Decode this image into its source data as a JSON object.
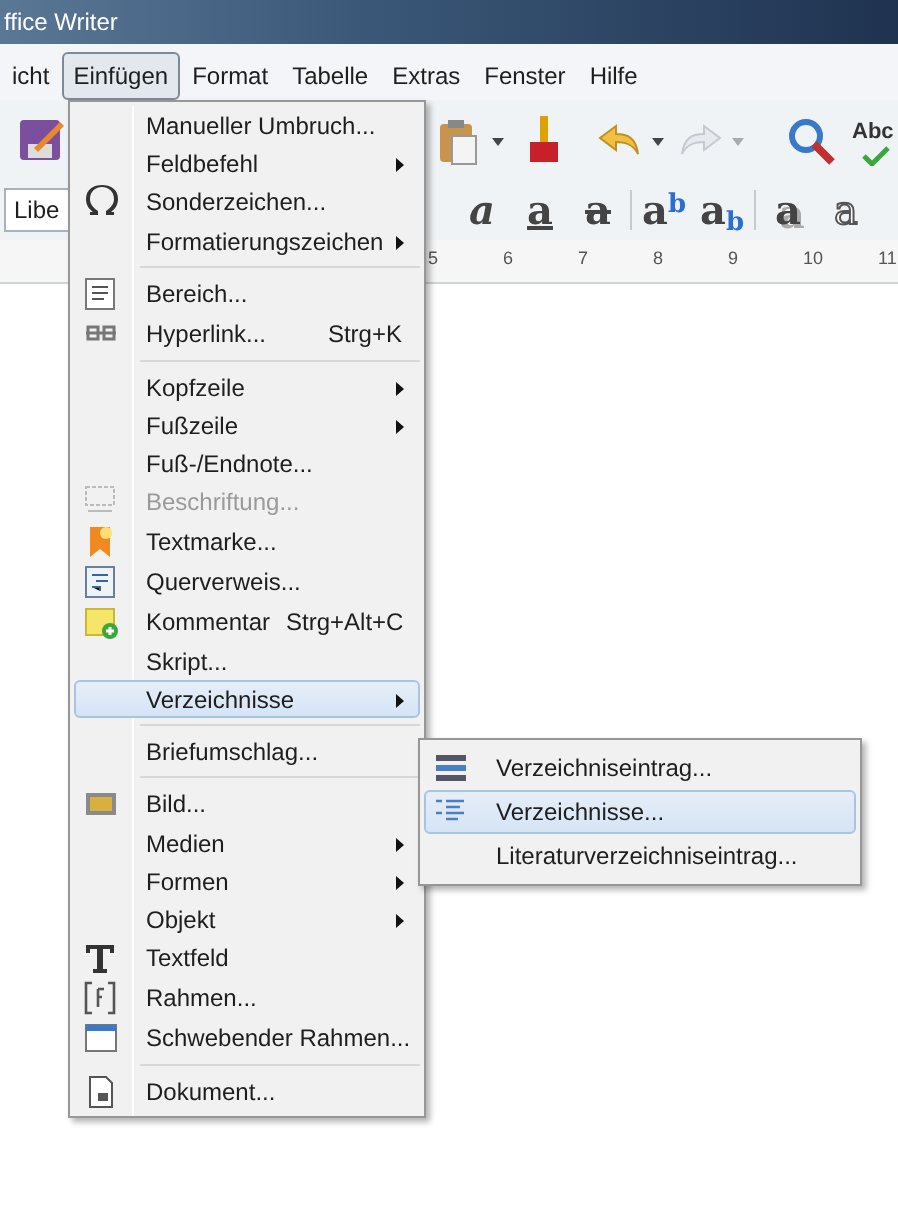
{
  "window": {
    "title": "ffice Writer"
  },
  "menubar": [
    {
      "label": "icht",
      "selected": false
    },
    {
      "label": "Einfügen",
      "selected": true
    },
    {
      "label": "Format",
      "selected": false
    },
    {
      "label": "Tabelle",
      "selected": false
    },
    {
      "label": "Extras",
      "selected": false
    },
    {
      "label": "Fenster",
      "selected": false
    },
    {
      "label": "Hilfe",
      "selected": false
    }
  ],
  "toolbar": {
    "font_name": "Libe",
    "spellcheck_label": "Abc"
  },
  "format_buttons": [
    {
      "kind": "italic",
      "label": "a"
    },
    {
      "kind": "underline",
      "label": "a"
    },
    {
      "kind": "strike",
      "label": "a"
    },
    {
      "kind": "sep"
    },
    {
      "kind": "superscript",
      "label": "a$^{b}$"
    },
    {
      "kind": "subscript",
      "label": "a$_{b}$"
    },
    {
      "kind": "sep"
    },
    {
      "kind": "shadow",
      "label": "a"
    },
    {
      "kind": "outline",
      "label": "a"
    }
  ],
  "ruler": {
    "numbers": [
      "5",
      "6",
      "7",
      "8",
      "9",
      "10",
      "11"
    ]
  },
  "menu": {
    "items": [
      {
        "kind": "plain",
        "label": "Manueller Umbruch...",
        "submenu": false,
        "disabled": false,
        "selected": false
      },
      {
        "kind": "plain",
        "label": "Feldbefehl",
        "submenu": true,
        "disabled": false,
        "selected": false
      },
      {
        "kind": "omega",
        "label": "Sonderzeichen...",
        "submenu": false,
        "disabled": false,
        "selected": false
      },
      {
        "kind": "plain",
        "label": "Formatierungszeichen",
        "submenu": true,
        "disabled": false,
        "selected": false
      },
      {
        "kind": "separator"
      },
      {
        "kind": "section",
        "label": "Bereich...",
        "submenu": false,
        "disabled": false,
        "selected": false
      },
      {
        "kind": "hyperlink",
        "label": "Hyperlink...",
        "shortcut": "Strg+K",
        "submenu": false,
        "disabled": false,
        "selected": false
      },
      {
        "kind": "separator"
      },
      {
        "kind": "plain",
        "label": "Kopfzeile",
        "submenu": true,
        "disabled": false,
        "selected": false
      },
      {
        "kind": "plain",
        "label": "Fußzeile",
        "submenu": true,
        "disabled": false,
        "selected": false
      },
      {
        "kind": "plain",
        "label": "Fuß-/Endnote...",
        "submenu": false,
        "disabled": false,
        "selected": false
      },
      {
        "kind": "caption",
        "label": "Beschriftung...",
        "submenu": false,
        "disabled": true,
        "selected": false
      },
      {
        "kind": "bookmark",
        "label": "Textmarke...",
        "submenu": false,
        "disabled": false,
        "selected": false
      },
      {
        "kind": "crossref",
        "label": "Querverweis...",
        "submenu": false,
        "disabled": false,
        "selected": false
      },
      {
        "kind": "comment",
        "label": "Kommentar",
        "shortcut": "Strg+Alt+C",
        "submenu": false,
        "disabled": false,
        "selected": false
      },
      {
        "kind": "plain",
        "label": "Skript...",
        "submenu": false,
        "disabled": false,
        "selected": false
      },
      {
        "kind": "plain",
        "label": "Verzeichnisse",
        "submenu": true,
        "disabled": false,
        "selected": true
      },
      {
        "kind": "separator"
      },
      {
        "kind": "plain",
        "label": "Briefumschlag...",
        "submenu": false,
        "disabled": false,
        "selected": false
      },
      {
        "kind": "separator"
      },
      {
        "kind": "image",
        "label": "Bild...",
        "submenu": false,
        "disabled": false,
        "selected": false
      },
      {
        "kind": "plain",
        "label": "Medien",
        "submenu": true,
        "disabled": false,
        "selected": false
      },
      {
        "kind": "plain",
        "label": "Formen",
        "submenu": true,
        "disabled": false,
        "selected": false
      },
      {
        "kind": "plain",
        "label": "Objekt",
        "submenu": true,
        "disabled": false,
        "selected": false
      },
      {
        "kind": "textbox",
        "label": "Textfeld",
        "submenu": false,
        "disabled": false,
        "selected": false
      },
      {
        "kind": "frame",
        "label": "Rahmen...",
        "submenu": false,
        "disabled": false,
        "selected": false
      },
      {
        "kind": "window",
        "label": "Schwebender Rahmen...",
        "submenu": false,
        "disabled": false,
        "selected": false
      },
      {
        "kind": "separator"
      },
      {
        "kind": "document",
        "label": "Dokument...",
        "submenu": false,
        "disabled": false,
        "selected": false
      }
    ]
  },
  "submenu": {
    "items": [
      {
        "kind": "indexentry",
        "label": "Verzeichniseintrag...",
        "selected": false
      },
      {
        "kind": "index",
        "label": "Verzeichnisse...",
        "selected": true
      },
      {
        "kind": "plain",
        "label": "Literaturverzeichniseintrag...",
        "selected": false
      }
    ]
  }
}
